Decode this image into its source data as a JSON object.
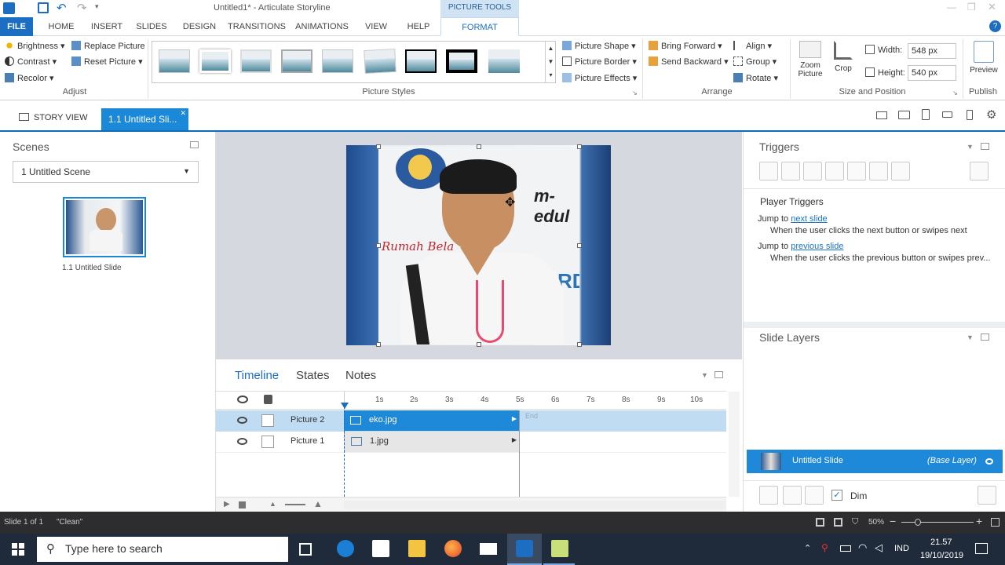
{
  "window": {
    "title": "Untitled1* - Articulate Storyline",
    "contextual_tab_header": "PICTURE TOOLS"
  },
  "ribbon_tabs": [
    "FILE",
    "HOME",
    "INSERT",
    "SLIDES",
    "DESIGN",
    "TRANSITIONS",
    "ANIMATIONS",
    "VIEW",
    "HELP",
    "FORMAT"
  ],
  "ribbon": {
    "adjust": {
      "brightness": "Brightness",
      "contrast": "Contrast",
      "recolor": "Recolor",
      "replace_picture": "Replace Picture",
      "reset_picture": "Reset Picture",
      "label": "Adjust"
    },
    "picture_styles": {
      "label": "Picture Styles",
      "picture_shape": "Picture Shape",
      "picture_border": "Picture Border",
      "picture_effects": "Picture Effects"
    },
    "arrange": {
      "label": "Arrange",
      "bring_forward": "Bring Forward",
      "send_backward": "Send Backward",
      "align": "Align",
      "group": "Group",
      "rotate": "Rotate"
    },
    "size": {
      "label": "Size and Position",
      "zoom_picture": "Zoom Picture",
      "crop": "Crop",
      "width_label": "Width:",
      "width_value": "548 px",
      "height_label": "Height:",
      "height_value": "540 px"
    },
    "publish": {
      "label": "Publish",
      "preview": "Preview"
    }
  },
  "view_tabs": {
    "story_view": "STORY VIEW",
    "slide_tab": "1.1 Untitled Sli..."
  },
  "scenes": {
    "title": "Scenes",
    "selected_scene": "1 Untitled Scene",
    "slide_label": "1.1 Untitled Slide"
  },
  "stage_image": {
    "sign_text_1": "m-edul",
    "sign_text_2": "Rumah Bela",
    "badge_text": "RD"
  },
  "triggers": {
    "title": "Triggers",
    "section": "Player Triggers",
    "items": [
      {
        "prefix": "Jump to",
        "link": "next slide",
        "description": "When the user clicks the next button or swipes next"
      },
      {
        "prefix": "Jump to",
        "link": "previous slide",
        "description": "When the user clicks the previous button or swipes prev..."
      }
    ]
  },
  "slide_layers": {
    "title": "Slide Layers",
    "base_name": "Untitled Slide",
    "base_tag": "(Base Layer)",
    "dim_label": "Dim"
  },
  "timeline": {
    "tabs": [
      "Timeline",
      "States",
      "Notes"
    ],
    "ticks": [
      "1s",
      "2s",
      "3s",
      "4s",
      "5s",
      "6s",
      "7s",
      "8s",
      "9s",
      "10s"
    ],
    "end_label": "End",
    "rows": [
      {
        "name": "Picture 2",
        "clip": "eko.jpg",
        "selected": true
      },
      {
        "name": "Picture 1",
        "clip": "1.jpg",
        "selected": false
      }
    ]
  },
  "status": {
    "slide_count": "Slide 1 of 1",
    "theme": "\"Clean\"",
    "zoom": "50%"
  },
  "taskbar": {
    "search_placeholder": "Type here to search",
    "lang": "IND",
    "time": "21.57",
    "date": "19/10/2019"
  },
  "colors": {
    "accent": "#0f6cbd",
    "selected_row": "#bfdcf2",
    "clip_selected": "#1e88d9",
    "status_bg": "#2d2d30"
  }
}
